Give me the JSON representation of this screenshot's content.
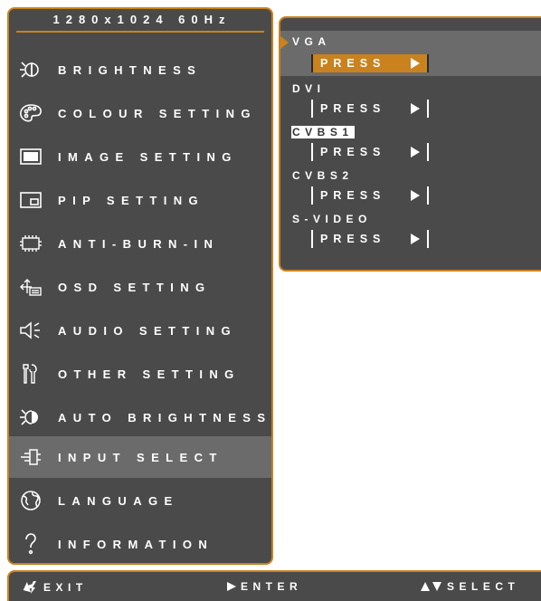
{
  "resolution": "1280x1024 60Hz",
  "menu": [
    {
      "label": "BRIGHTNESS",
      "icon": "brightness-icon"
    },
    {
      "label": "COLOUR SETTING",
      "icon": "palette-icon"
    },
    {
      "label": "IMAGE SETTING",
      "icon": "image-icon"
    },
    {
      "label": "PIP SETTING",
      "icon": "pip-icon"
    },
    {
      "label": "ANTI-BURN-IN",
      "icon": "chip-icon"
    },
    {
      "label": "OSD SETTING",
      "icon": "osd-icon"
    },
    {
      "label": "AUDIO SETTING",
      "icon": "speaker-icon"
    },
    {
      "label": "OTHER SETTING",
      "icon": "tools-icon"
    },
    {
      "label": "AUTO BRIGHTNESS",
      "icon": "auto-brightness-icon"
    },
    {
      "label": "INPUT SELECT",
      "icon": "plug-icon",
      "selected": true
    },
    {
      "label": "LANGUAGE",
      "icon": "globe-icon"
    },
    {
      "label": "INFORMATION",
      "icon": "question-icon"
    }
  ],
  "submenu": [
    {
      "label": "VGA",
      "action": "PRESS",
      "selected": true
    },
    {
      "label": "DVI",
      "action": "PRESS"
    },
    {
      "label": "CVBS1",
      "action": "PRESS",
      "highlighted": true
    },
    {
      "label": "CVBS2",
      "action": "PRESS"
    },
    {
      "label": "S-VIDEO",
      "action": "PRESS"
    }
  ],
  "footer": {
    "exit": "EXIT",
    "enter": "ENTER",
    "select": "SELECT"
  },
  "colors": {
    "accent": "#c9821e",
    "panel": "#4a4a4a",
    "selected_row": "#6b6b6b"
  }
}
